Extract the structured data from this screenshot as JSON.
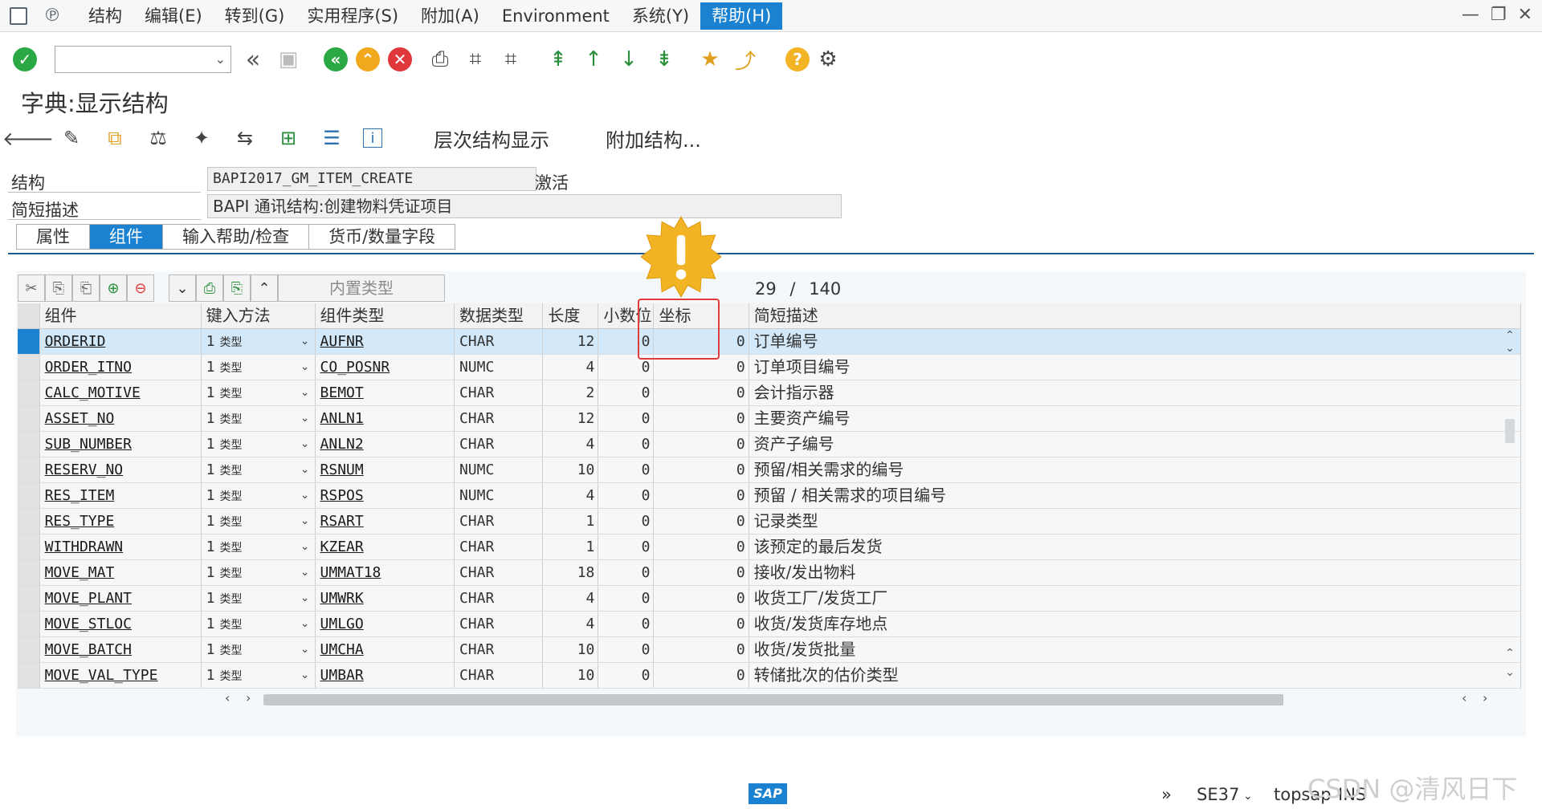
{
  "menubar": {
    "items": [
      "结构",
      "编辑(E)",
      "转到(G)",
      "实用程序(S)",
      "附加(A)",
      "Environment",
      "系统(Y)",
      "帮助(H)"
    ],
    "active": "帮助(H)"
  },
  "title": "字典:显示结构",
  "apptoolbar": {
    "hierarchy": "层次结构显示",
    "append": "附加结构..."
  },
  "header": {
    "struct_label": "结构",
    "struct_value": "BAPI2017_GM_ITEM_CREATE",
    "status": "激活",
    "desc_label": "简短描述",
    "desc_value": "BAPI 通讯结构:创建物料凭证项目"
  },
  "tabs": [
    "属性",
    "组件",
    "输入帮助/检查",
    "货币/数量字段"
  ],
  "active_tab": "组件",
  "table_toolbar": {
    "inbuilt_type": "内置类型",
    "counter_current": "29",
    "counter_sep": "/",
    "counter_total": "140"
  },
  "columns": [
    "组件",
    "键入方法",
    "组件类型",
    "数据类型",
    "长度",
    "小数位",
    "坐标",
    "简短描述"
  ],
  "rows": [
    {
      "comp": "ORDERID",
      "m1": "1",
      "m2": "类型",
      "type": "AUFNR",
      "dt": "CHAR",
      "len": "12",
      "dec": "0",
      "coord": "0",
      "desc": "订单编号"
    },
    {
      "comp": "ORDER_ITNO",
      "m1": "1",
      "m2": "类型",
      "type": "CO_POSNR",
      "dt": "NUMC",
      "len": "4",
      "dec": "0",
      "coord": "0",
      "desc": "订单项目编号"
    },
    {
      "comp": "CALC_MOTIVE",
      "m1": "1",
      "m2": "类型",
      "type": "BEMOT",
      "dt": "CHAR",
      "len": "2",
      "dec": "0",
      "coord": "0",
      "desc": "会计指示器"
    },
    {
      "comp": "ASSET_NO",
      "m1": "1",
      "m2": "类型",
      "type": "ANLN1",
      "dt": "CHAR",
      "len": "12",
      "dec": "0",
      "coord": "0",
      "desc": "主要资产编号"
    },
    {
      "comp": "SUB_NUMBER",
      "m1": "1",
      "m2": "类型",
      "type": "ANLN2",
      "dt": "CHAR",
      "len": "4",
      "dec": "0",
      "coord": "0",
      "desc": "资产子编号"
    },
    {
      "comp": "RESERV_NO",
      "m1": "1",
      "m2": "类型",
      "type": "RSNUM",
      "dt": "NUMC",
      "len": "10",
      "dec": "0",
      "coord": "0",
      "desc": "预留/相关需求的编号"
    },
    {
      "comp": "RES_ITEM",
      "m1": "1",
      "m2": "类型",
      "type": "RSPOS",
      "dt": "NUMC",
      "len": "4",
      "dec": "0",
      "coord": "0",
      "desc": "预留 / 相关需求的项目编号"
    },
    {
      "comp": "RES_TYPE",
      "m1": "1",
      "m2": "类型",
      "type": "RSART",
      "dt": "CHAR",
      "len": "1",
      "dec": "0",
      "coord": "0",
      "desc": "记录类型"
    },
    {
      "comp": "WITHDRAWN",
      "m1": "1",
      "m2": "类型",
      "type": "KZEAR",
      "dt": "CHAR",
      "len": "1",
      "dec": "0",
      "coord": "0",
      "desc": "该预定的最后发货"
    },
    {
      "comp": "MOVE_MAT",
      "m1": "1",
      "m2": "类型",
      "type": "UMMAT18",
      "dt": "CHAR",
      "len": "18",
      "dec": "0",
      "coord": "0",
      "desc": "接收/发出物料"
    },
    {
      "comp": "MOVE_PLANT",
      "m1": "1",
      "m2": "类型",
      "type": "UMWRK",
      "dt": "CHAR",
      "len": "4",
      "dec": "0",
      "coord": "0",
      "desc": "收货工厂/发货工厂"
    },
    {
      "comp": "MOVE_STLOC",
      "m1": "1",
      "m2": "类型",
      "type": "UMLGO",
      "dt": "CHAR",
      "len": "4",
      "dec": "0",
      "coord": "0",
      "desc": "收货/发货库存地点"
    },
    {
      "comp": "MOVE_BATCH",
      "m1": "1",
      "m2": "类型",
      "type": "UMCHA",
      "dt": "CHAR",
      "len": "10",
      "dec": "0",
      "coord": "0",
      "desc": "收货/发货批量"
    },
    {
      "comp": "MOVE_VAL_TYPE",
      "m1": "1",
      "m2": "类型",
      "type": "UMBAR",
      "dt": "CHAR",
      "len": "10",
      "dec": "0",
      "coord": "0",
      "desc": "转储批次的估价类型"
    }
  ],
  "statusbar": {
    "logo": "SAP",
    "tcode": "SE37",
    "server": "topsap",
    "mode": "INS"
  },
  "watermark": "CSDN @清风日下",
  "colors": {
    "accent": "#1b82d1",
    "highlight": "#e23b3b",
    "alert": "#f2b324"
  }
}
